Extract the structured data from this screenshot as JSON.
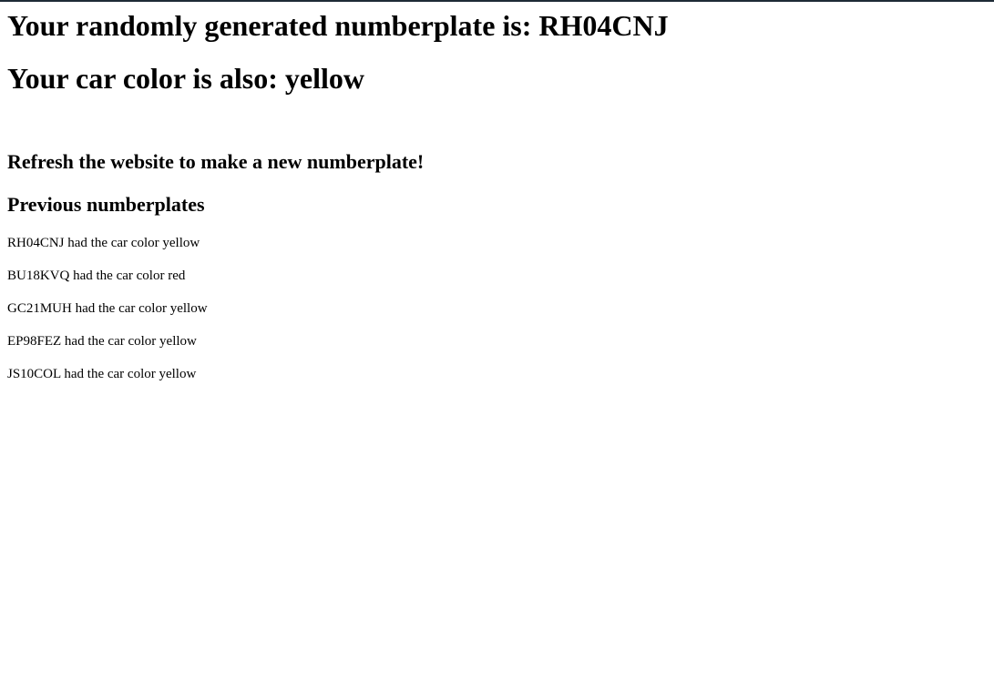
{
  "plate": {
    "prefix": "Your randomly generated numberplate is: ",
    "value": "RH04CNJ"
  },
  "color": {
    "prefix": "Your car color is also: ",
    "value": "yellow"
  },
  "refresh_message": "Refresh the website to make a new numberplate!",
  "previous_heading": "Previous numberplates",
  "history": [
    "RH04CNJ had the car color yellow",
    "BU18KVQ had the car color red",
    "GC21MUH had the car color yellow",
    "EP98FEZ had the car color yellow",
    "JS10COL had the car color yellow"
  ],
  "colors": {
    "top_bar": "#1e2b36",
    "background": "#ffffff",
    "text": "#000000"
  }
}
